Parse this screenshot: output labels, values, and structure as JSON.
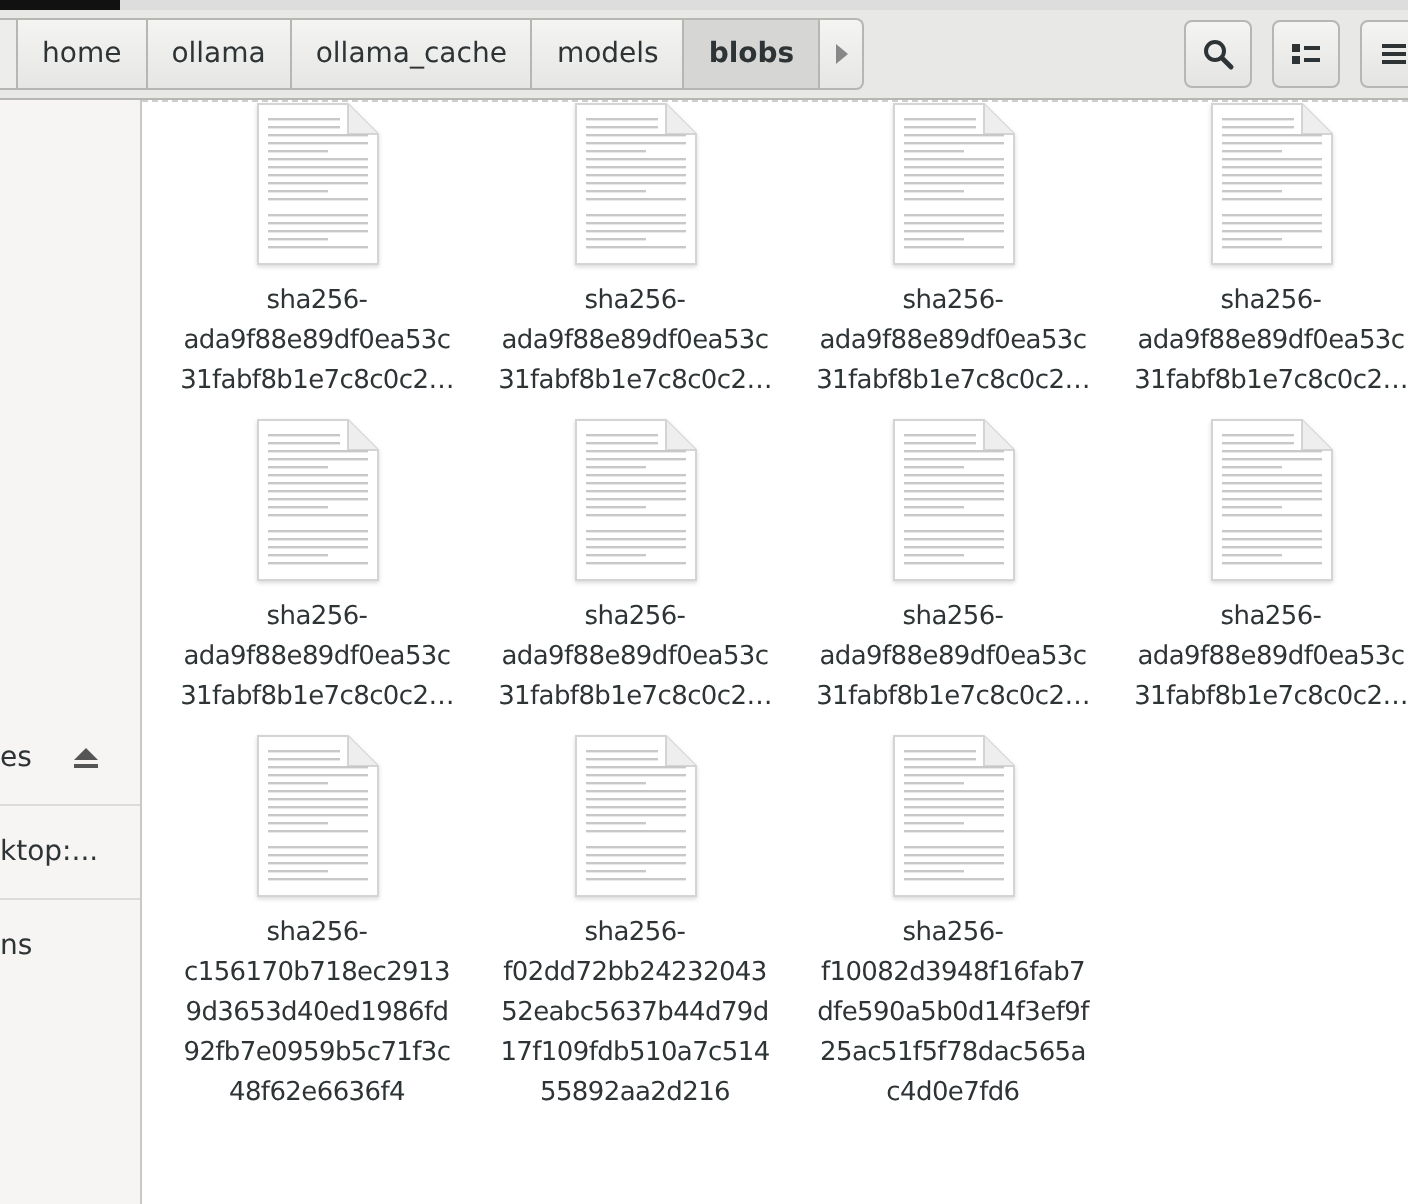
{
  "path_bar": {
    "segments": [
      {
        "label": "home",
        "selected": false
      },
      {
        "label": "ollama",
        "selected": false
      },
      {
        "label": "ollama_cache",
        "selected": false
      },
      {
        "label": "models",
        "selected": false
      },
      {
        "label": "blobs",
        "selected": true
      }
    ]
  },
  "sidebar": {
    "items": [
      {
        "label": "es",
        "kind": "mount"
      },
      {
        "label": "ktop:...",
        "kind": "plain"
      },
      {
        "label": "ns",
        "kind": "plain"
      }
    ]
  },
  "files": [
    {
      "name_lines": [
        "sha256-",
        "ada9f88e89df0ea53c",
        "31fabf8b1e7c8c0c2…"
      ]
    },
    {
      "name_lines": [
        "sha256-",
        "ada9f88e89df0ea53c",
        "31fabf8b1e7c8c0c2…"
      ]
    },
    {
      "name_lines": [
        "sha256-",
        "ada9f88e89df0ea53c",
        "31fabf8b1e7c8c0c2…"
      ]
    },
    {
      "name_lines": [
        "sha256-",
        "ada9f88e89df0ea53c",
        "31fabf8b1e7c8c0c2…"
      ]
    },
    {
      "name_lines": [
        "sha256-",
        "ada9f88e89df0ea53c",
        "31fabf8b1e7c8c0c2…"
      ]
    },
    {
      "name_lines": [
        "sha256-",
        "ada9f88e89df0ea53c",
        "31fabf8b1e7c8c0c2…"
      ]
    },
    {
      "name_lines": [
        "sha256-",
        "ada9f88e89df0ea53c",
        "31fabf8b1e7c8c0c2…"
      ]
    },
    {
      "name_lines": [
        "sha256-",
        "ada9f88e89df0ea53c",
        "31fabf8b1e7c8c0c2…"
      ]
    },
    {
      "name_lines": [
        "sha256-",
        "c156170b718ec2913",
        "9d3653d40ed1986fd",
        "92fb7e0959b5c71f3c",
        "48f62e6636f4"
      ]
    },
    {
      "name_lines": [
        "sha256-",
        "f02dd72bb24232043",
        "52eabc5637b44d79d",
        "17f109fdb510a7c514",
        "55892aa2d216"
      ]
    },
    {
      "name_lines": [
        "sha256-",
        "f10082d3948f16fab7",
        "dfe590a5b0d14f3ef9f",
        "25ac51f5f78dac565a",
        "c4d0e7fd6"
      ]
    }
  ]
}
